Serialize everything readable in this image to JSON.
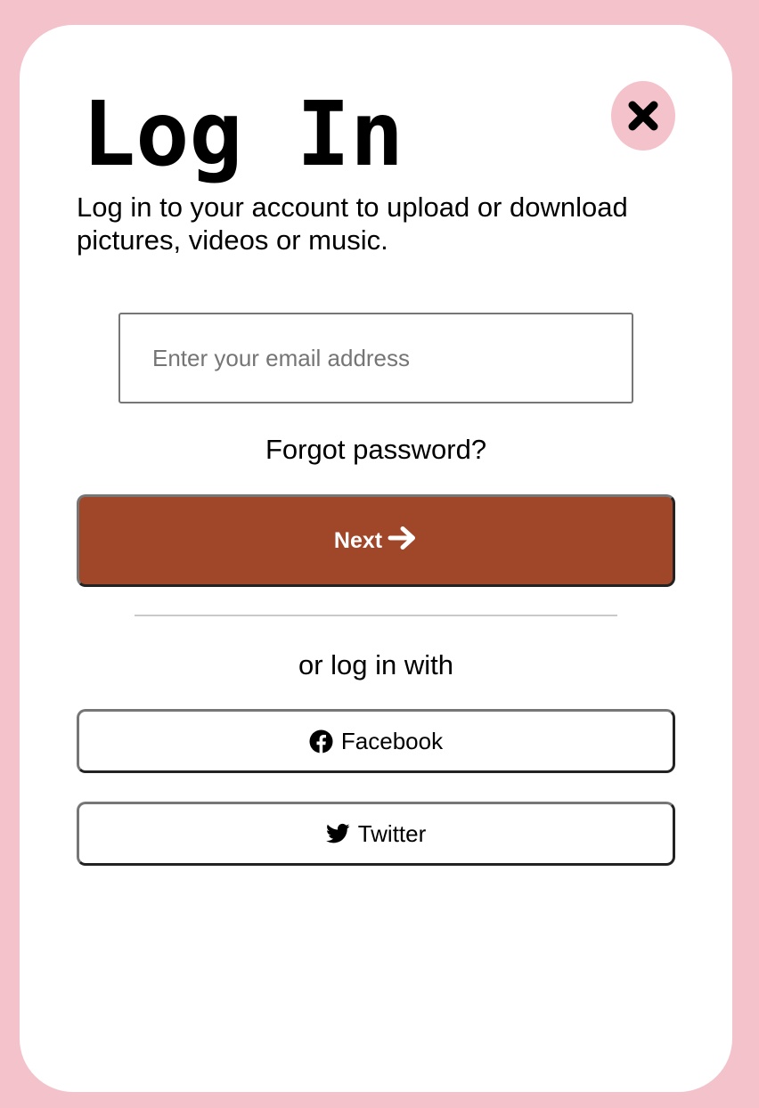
{
  "login_card": {
    "title": "Log In",
    "subtitle": "Log in to your account to upload or download pictures, videos or music.",
    "close_icon": "close-icon",
    "email_input": {
      "value": "",
      "placeholder": "Enter your email address"
    },
    "forgot_password_label": "Forgot password?",
    "next_button": {
      "label": "Next",
      "icon": "arrow-right-icon"
    },
    "or_text": "or log in with",
    "social_buttons": [
      {
        "label": "Facebook",
        "icon": "facebook-icon"
      },
      {
        "label": "Twitter",
        "icon": "twitter-icon"
      }
    ]
  },
  "colors": {
    "background": "#f4c2cb",
    "card": "#ffffff",
    "accent": "#a0472a",
    "close_button": "#f4c2cb"
  }
}
